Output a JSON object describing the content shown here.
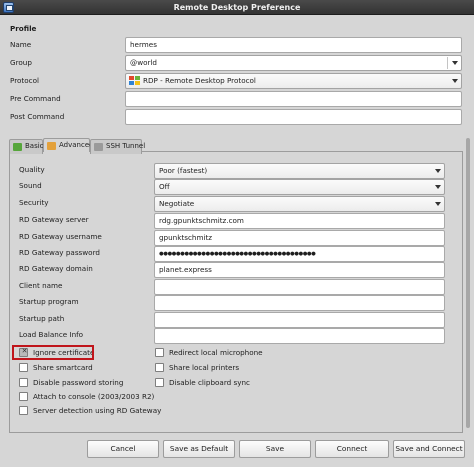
{
  "window": {
    "title": "Remote Desktop Preference"
  },
  "profile": {
    "section_title": "Profile",
    "name_label": "Name",
    "name_value": "hermes",
    "group_label": "Group",
    "group_value": "@world",
    "protocol_label": "Protocol",
    "protocol_value": "RDP - Remote Desktop Protocol",
    "pre_command_label": "Pre Command",
    "pre_command_value": "",
    "post_command_label": "Post Command",
    "post_command_value": ""
  },
  "tabs": [
    {
      "label": "Basic",
      "active": false
    },
    {
      "label": "Advanced",
      "active": true
    },
    {
      "label": "SSH Tunnel",
      "active": false
    }
  ],
  "advanced": {
    "quality_label": "Quality",
    "quality_value": "Poor (fastest)",
    "sound_label": "Sound",
    "sound_value": "Off",
    "security_label": "Security",
    "security_value": "Negotiate",
    "gateway_server_label": "RD Gateway server",
    "gateway_server_value": "rdg.gpunktschmitz.com",
    "gateway_username_label": "RD Gateway username",
    "gateway_username_value": "gpunktschmitz",
    "gateway_password_label": "RD Gateway password",
    "gateway_password_value": "●●●●●●●●●●●●●●●●●●●●●●●●●●●●●●●●●●●●●",
    "gateway_domain_label": "RD Gateway domain",
    "gateway_domain_value": "planet.express",
    "client_name_label": "Client name",
    "client_name_value": "",
    "startup_program_label": "Startup program",
    "startup_program_value": "",
    "startup_path_label": "Startup path",
    "startup_path_value": "",
    "load_balance_label": "Load Balance Info",
    "load_balance_value": ""
  },
  "checkboxes": {
    "left": [
      {
        "label": "Ignore certificate",
        "checked": true
      },
      {
        "label": "Share smartcard",
        "checked": false
      },
      {
        "label": "Disable password storing",
        "checked": false
      },
      {
        "label": "Attach to console (2003/2003 R2)",
        "checked": false
      },
      {
        "label": "Server detection using RD Gateway",
        "checked": false
      }
    ],
    "right": [
      {
        "label": "Redirect local microphone",
        "checked": false
      },
      {
        "label": "Share local printers",
        "checked": false
      },
      {
        "label": "Disable clipboard sync",
        "checked": false
      }
    ]
  },
  "buttons": {
    "cancel": "Cancel",
    "save_as_default": "Save as Default",
    "save": "Save",
    "connect": "Connect",
    "save_and_connect": "Save and Connect"
  },
  "colors": {
    "titlebar": "#3d3d3d",
    "window_bg": "#d6d6d6",
    "highlight_box": "#c0151b"
  }
}
